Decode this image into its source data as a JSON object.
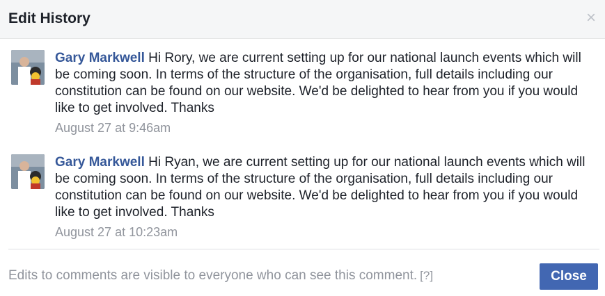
{
  "dialog": {
    "title": "Edit History",
    "close_icon": "close-x-icon"
  },
  "entries": [
    {
      "author": "Gary Markwell",
      "text": "Hi Rory, we are current setting up for our national launch events which will be coming soon. In terms of the structure of the organisation, full details including our constitution can be found on our website. We'd be delighted to hear from you if you would like to get involved. Thanks",
      "timestamp": "August 27 at 9:46am"
    },
    {
      "author": "Gary Markwell",
      "text": "Hi Ryan, we are current setting up for our national launch events which will be coming soon. In terms of the structure of the organisation, full details including our constitution can be found on our website. We'd be delighted to hear from you if you would like to get involved. Thanks",
      "timestamp": "August 27 at 10:23am"
    }
  ],
  "footer": {
    "note": "Edits to comments are visible to everyone who can see this comment.",
    "help_link": "[?]",
    "close_label": "Close"
  },
  "colors": {
    "link": "#365899",
    "muted": "#90949c",
    "button": "#4267b2",
    "header_bg": "#f5f6f7"
  }
}
